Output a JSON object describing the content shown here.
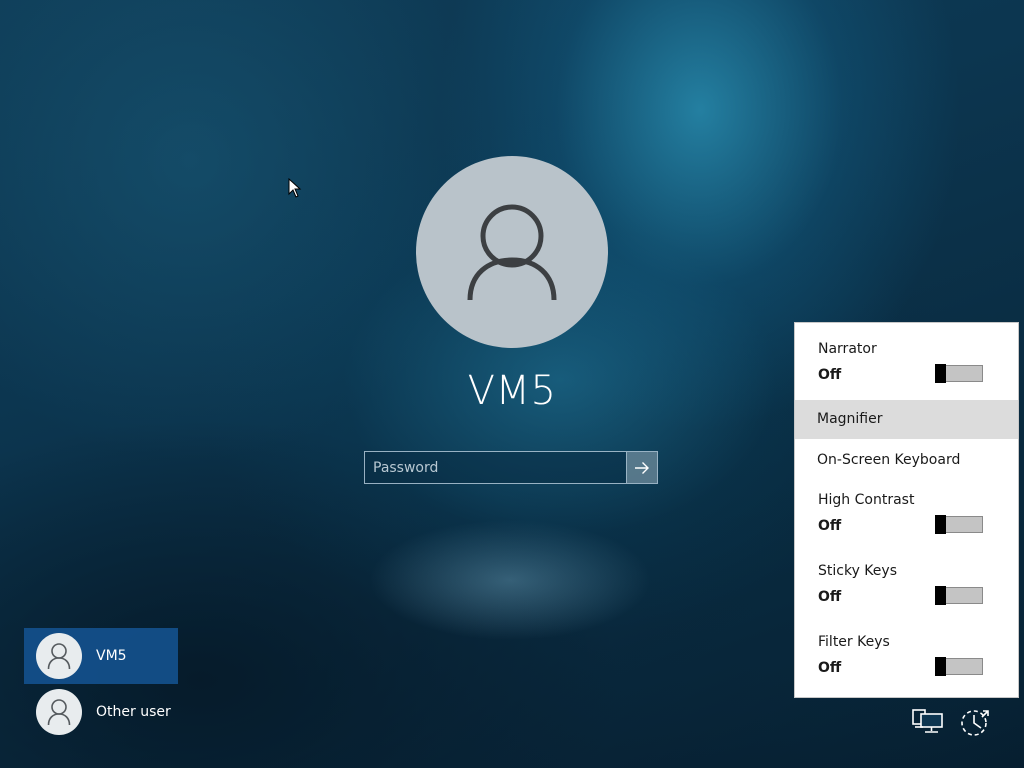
{
  "user": {
    "name": "VM5"
  },
  "password": {
    "placeholder": "Password"
  },
  "user_list": [
    {
      "label": "VM5",
      "selected": true
    },
    {
      "label": "Other user",
      "selected": false
    }
  ],
  "ease_of_access": {
    "narrator": {
      "title": "Narrator",
      "state": "Off"
    },
    "magnifier": {
      "title": "Magnifier"
    },
    "on_screen_keyboard": {
      "title": "On-Screen Keyboard"
    },
    "high_contrast": {
      "title": "High Contrast",
      "state": "Off"
    },
    "sticky_keys": {
      "title": "Sticky Keys",
      "state": "Off"
    },
    "filter_keys": {
      "title": "Filter Keys",
      "state": "Off"
    }
  },
  "icons": {
    "network": "network-icon",
    "ease_of_access": "ease-of-access-icon",
    "submit": "arrow-right-icon",
    "user": "user-icon"
  },
  "colors": {
    "selected_user": "#14508c",
    "avatar_bg": "#b9c3ca",
    "panel_bg": "#ffffff",
    "highlight_row": "#dcdcdc"
  }
}
